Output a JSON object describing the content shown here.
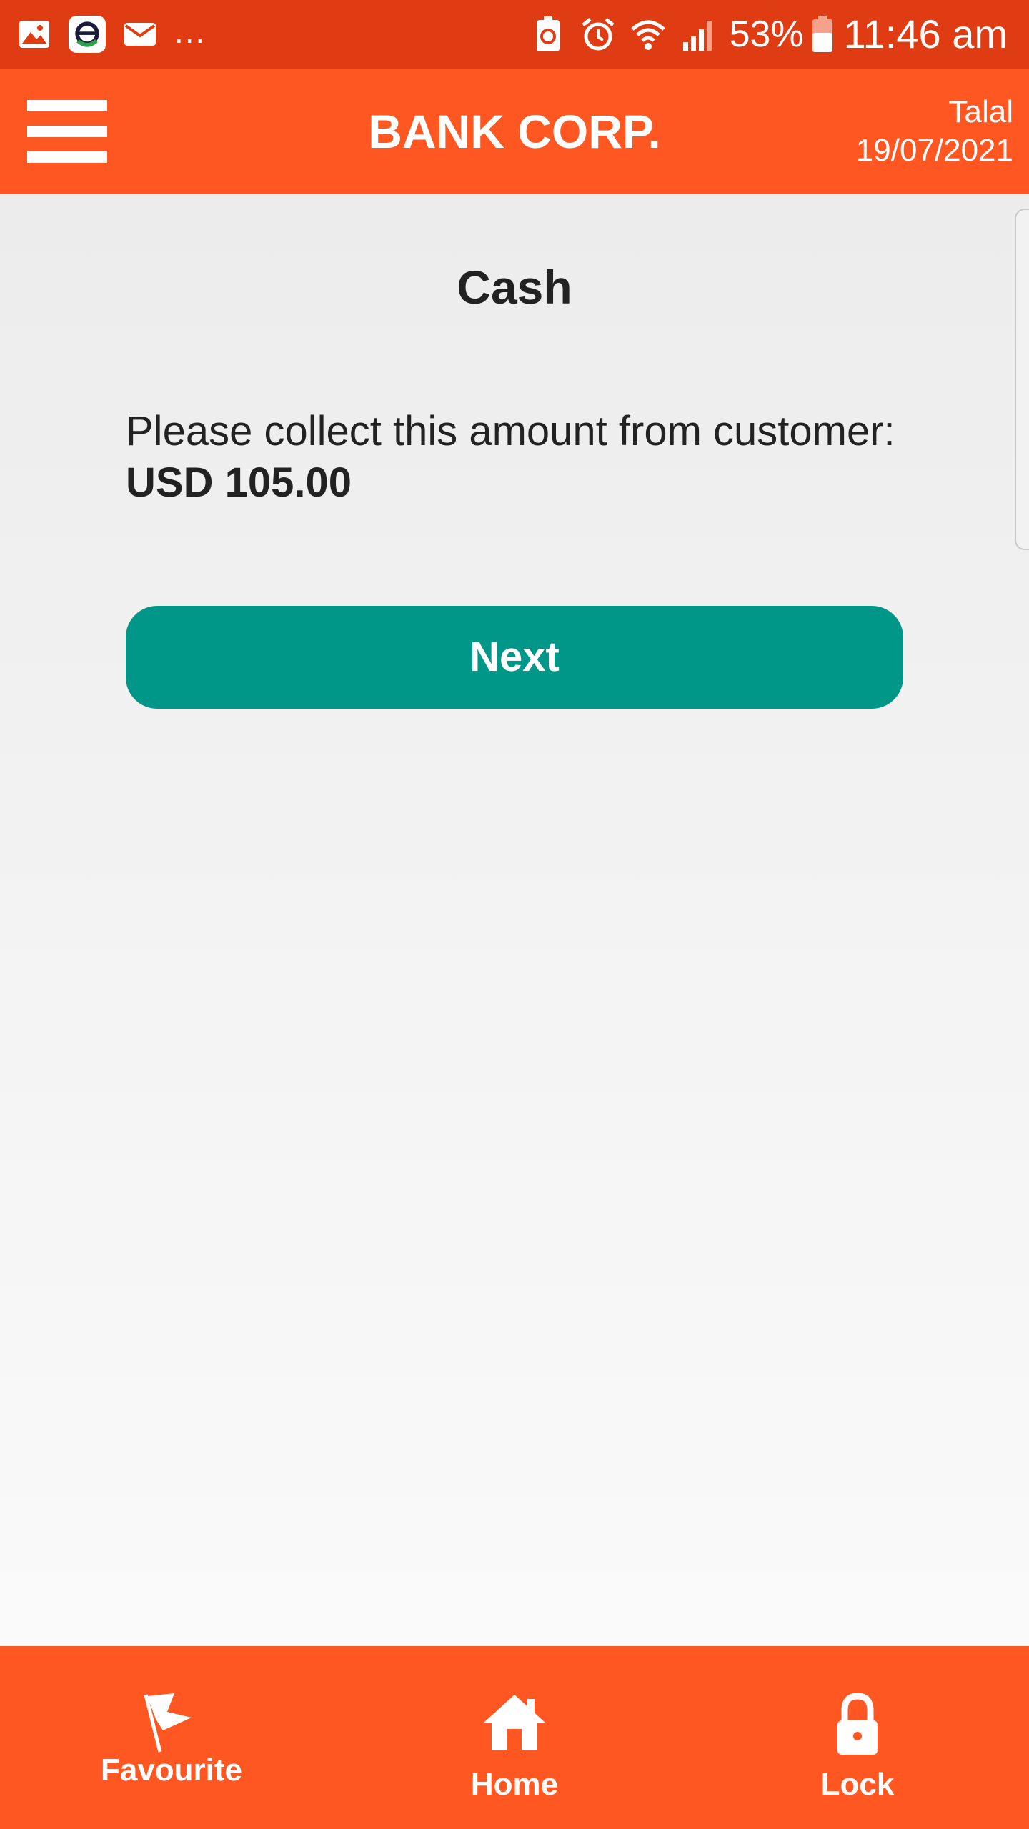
{
  "status_bar": {
    "left_icons": [
      "gallery-icon",
      "app-notification-icon",
      "mail-icon"
    ],
    "more_indicator": "...",
    "right_icons": [
      "battery-saver-icon",
      "alarm-icon",
      "wifi-icon",
      "signal-icon"
    ],
    "battery_percent": "53%",
    "time": "11:46 am"
  },
  "header": {
    "title": "BANK CORP.",
    "user_name": "Talal",
    "date": "19/07/2021",
    "menu_icon": "hamburger-menu-icon"
  },
  "main": {
    "heading": "Cash",
    "message_prefix": "Please collect this amount from customer:",
    "amount": "USD 105.00",
    "next_label": "Next"
  },
  "bottom_nav": {
    "items": [
      {
        "label": "Favourite",
        "icon": "flag-icon"
      },
      {
        "label": "Home",
        "icon": "home-icon"
      },
      {
        "label": "Lock",
        "icon": "lock-icon"
      }
    ]
  },
  "colors": {
    "status_bar": "#e03c14",
    "header": "#ff5722",
    "button": "#009688",
    "bottom_nav": "#ff5722",
    "text_dark": "#222222"
  }
}
